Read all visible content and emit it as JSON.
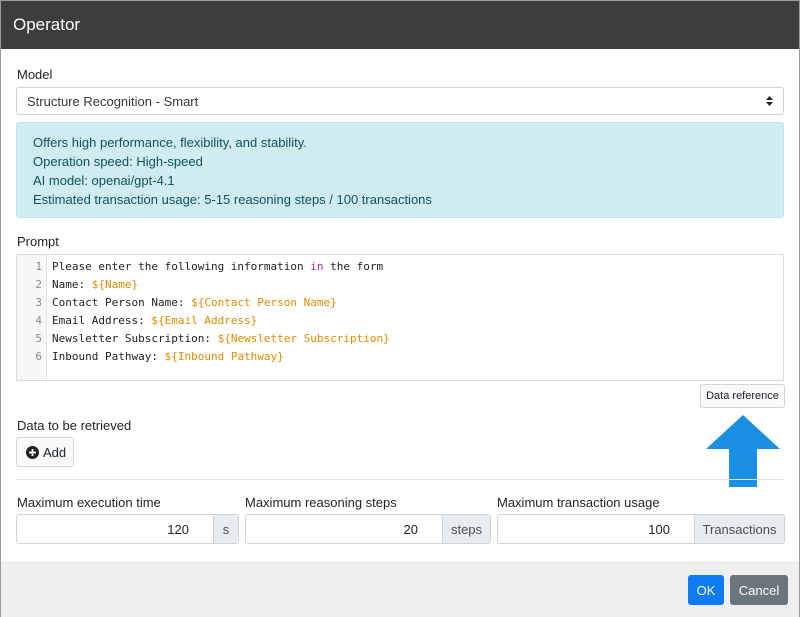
{
  "dialog": {
    "title": "Operator"
  },
  "model": {
    "label": "Model",
    "selected": "Structure Recognition - Smart"
  },
  "info": {
    "lines": [
      "Offers high performance, flexibility, and stability.",
      "Operation speed: High-speed",
      "AI model: openai/gpt-4.1",
      "Estimated transaction usage: 5-15 reasoning steps / 100 transactions"
    ]
  },
  "prompt": {
    "label": "Prompt",
    "line_numbers": [
      "1",
      "2",
      "3",
      "4",
      "5",
      "6"
    ],
    "lines": [
      {
        "pre": "Please enter the following information ",
        "kw": "in",
        "post": " the form"
      },
      {
        "pre": "Name: ",
        "var": "${Name}"
      },
      {
        "pre": "Contact Person Name: ",
        "var": "${Contact Person Name}"
      },
      {
        "pre": "Email Address: ",
        "var": "${Email Address}"
      },
      {
        "pre": "Newsletter Subscription: ",
        "var": "${Newsletter Subscription}"
      },
      {
        "pre": "Inbound Pathway: ",
        "var": "${Inbound Pathway}"
      }
    ],
    "data_reference_label": "Data reference"
  },
  "retrieved": {
    "label": "Data to be retrieved",
    "add_label": "Add"
  },
  "limits": {
    "execution_time": {
      "label": "Maximum execution time",
      "value": "120",
      "unit": "s"
    },
    "reasoning_steps": {
      "label": "Maximum reasoning steps",
      "value": "20",
      "unit": "steps"
    },
    "transaction_usage": {
      "label": "Maximum transaction usage",
      "value": "100",
      "unit": "Transactions"
    }
  },
  "footer": {
    "ok_label": "OK",
    "cancel_label": "Cancel"
  },
  "colors": {
    "header_bg": "#3d3d3d",
    "info_bg": "#d1ecf1",
    "info_text": "#0c5460",
    "variable": "#e08a00",
    "keyword": "#a02ea0",
    "primary": "#0d7cf2",
    "secondary": "#6c757d",
    "arrow": "#1a8fe3"
  },
  "icons": {
    "select_caret": "sort-caret-icon",
    "add": "plus-circle-icon",
    "pointer": "up-arrow-icon"
  }
}
